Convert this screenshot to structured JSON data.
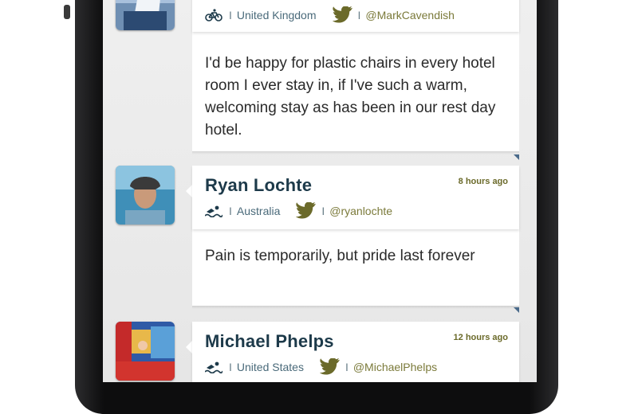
{
  "feed": {
    "items": [
      {
        "name": "",
        "time": "",
        "country": "United Kingdom",
        "handle": "@MarkCavendish",
        "separator_left": "I",
        "separator_right": "I",
        "sport_icon": "cycling-icon",
        "message": "I'd be happy for plastic chairs in every hotel room I ever stay in, if I've such a warm, welcoming stay as has been in our rest day hotel."
      },
      {
        "name": "Ryan Lochte",
        "time": "8 hours ago",
        "country": "Australia",
        "handle": "@ryanlochte",
        "separator_left": "I",
        "separator_right": "I",
        "sport_icon": "swimming-icon",
        "message": "Pain is temporarily, but pride last forever"
      },
      {
        "name": "Michael Phelps",
        "time": "12 hours ago",
        "country": "United States",
        "handle": "@MichaelPhelps",
        "separator_left": "I",
        "separator_right": "I",
        "sport_icon": "swimming-icon",
        "message": ""
      }
    ]
  },
  "colors": {
    "name_text": "#1d3a4a",
    "time_text": "#6b6a2a",
    "meta_text": "#4a6a7a",
    "handle_text": "#7b7a3a",
    "twitter_bird": "#6b6a2a",
    "screen_bg": "#ececec",
    "phone_body": "#1f1f21"
  }
}
